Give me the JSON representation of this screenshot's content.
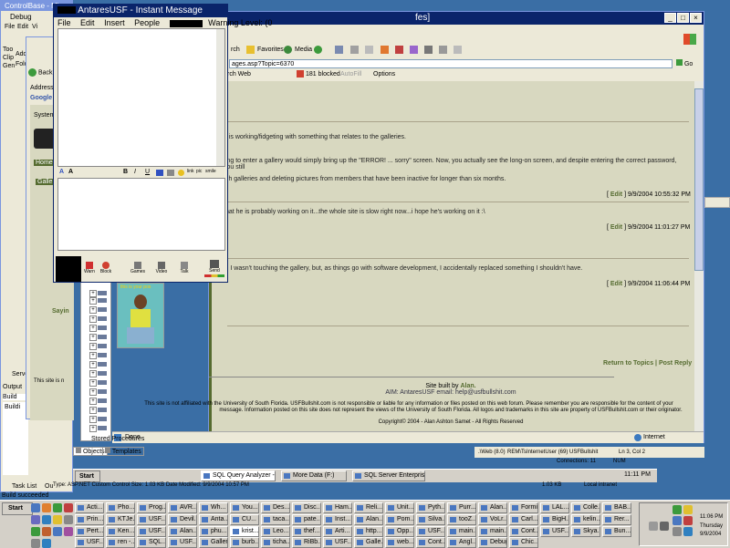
{
  "desktop": {
    "background_color": "#3a6ea5",
    "controlbase_title": "ControlBase - Mi",
    "debug_tab": "Debug",
    "left_menu": [
      "File",
      "Edit",
      "Vi"
    ],
    "left_labels": [
      "Too",
      "Clip",
      "Gen",
      "Addre",
      "Folde"
    ],
    "output_label": "Output",
    "build_label": "Build",
    "building_text": "Buildi",
    "server_label": "Serve",
    "task_list_tab": "Task List",
    "output_tab": "Ou",
    "build_status": "Build succeeded",
    "type_info": "Type: ASP.NET Custom Control  Size: 1.03 KB  Date Modified: 9/9/2004 10:57 PM",
    "type_info_size": "1.03 KB",
    "local_intranet": "Local intranet"
  },
  "im_window": {
    "title": "AntaresUSF - Instant Message",
    "warning": "Warning Level: (0",
    "menu": [
      "File",
      "Edit",
      "Insert",
      "People"
    ],
    "format_buttons": [
      "A",
      "A",
      "B",
      "I",
      "U",
      "link",
      "pic",
      "smile"
    ],
    "bottom_buttons": [
      {
        "icon": "warn-icon",
        "label": "Warn"
      },
      {
        "icon": "block-icon",
        "label": "Block"
      },
      {
        "icon": "games-icon",
        "label": "Games"
      },
      {
        "icon": "video-icon",
        "label": "Video"
      },
      {
        "icon": "talk-icon",
        "label": "Talk"
      },
      {
        "icon": "send-icon",
        "label": "Send"
      }
    ]
  },
  "small_browser": {
    "back_label": "Back",
    "address_label": "Address",
    "google_label": "Google",
    "system_label": "System",
    "home_label": "Home",
    "gallery_label": "Galle",
    "saying_label": "Sayin",
    "site_label": "This site is n"
  },
  "ie_window": {
    "title_suffix": "fes]",
    "toolbar": {
      "search": "rch",
      "favorites": "Favorites",
      "media": "Media"
    },
    "address": "ages.asp?Topic=6370",
    "go_label": "Go",
    "links_row": {
      "search_web": "rch Web",
      "blocked": "181 blocked",
      "autofill": "AutoFill",
      "options": "Options"
    },
    "posts": [
      {
        "text": "n is working/fidgeting with something that relates to the galleries.",
        "meta": null
      },
      {
        "text": "ting to enter a gallery would simply bring up the \"ERROR! ... sorry\" screen. Now, you actually see the long-on screen, and despite entering the correct password, you still",
        "meta": null
      },
      {
        "text": "igh galleries and deleting pictures from members that have been inactive for longer than six months.",
        "meta": {
          "edit": "Edit",
          "date": "9/9/2004 10:55:32 PM"
        }
      },
      {
        "text": "that he is probably working on it...the whole site is slow right now...i hope he's working on it :\\",
        "meta": {
          "edit": "Edit",
          "date": "9/9/2004 11:01:27 PM"
        }
      },
      {
        "text": "s. I wasn't touching the gallery, but, as things go with software development, I accidentally replaced something I shouldn't have.",
        "meta": {
          "edit": "Edit",
          "date": "9/9/2004 11:06:44 PM"
        }
      }
    ],
    "return_label": "Return to Topics",
    "post_reply_label": "Post Reply",
    "footer": {
      "built_by_prefix": "Site built by",
      "built_by_name": "Alan.",
      "aim": "AIM: AntaresUSF email: help@usfbullshit.com",
      "disclaimer_1": "This site is not affiliated with the University of South Florida. USFBullshit.com is not responsible or liable for any information or files posted on this web forum. Please remember you are responsible for the content of your",
      "disclaimer_2": "message. Information posted on this site does not represent the views of the University of South Florida. All logos and trademarks in this site are property of USFBullshit.com or their originator.",
      "copyright": "Copyright© 2004 - Alan Ashton Samet - All Rights Reserved"
    },
    "status_done": "Done",
    "status_zone": "Internet",
    "image_caption": "this is your pos",
    "accent_color": "#556b2f",
    "forum_bg": "#d8d8c0"
  },
  "sql_window": {
    "status_cells": [
      ".\\Web (8.0)",
      "REM\\TsInternetUser (69)",
      "USFBullshit",
      "Ln 3, Col 2"
    ],
    "connections": "Connections: 11",
    "num": "NUM",
    "tree_last": "Stored Procedures",
    "tabs": [
      "Objects",
      "Templates"
    ]
  },
  "taskbar": {
    "start": "Start",
    "items_row1": [
      "SQL Query Analyzer - [...",
      "More Data (F:)",
      "SQL Server Enterprise Ma..."
    ],
    "clock1": "11:11 PM",
    "clock2": "11:06 PM",
    "day": "Thursday",
    "date": "9/9/2004",
    "bottom_tasks_row1": [
      "Acti...",
      "Pho...",
      "Prog...",
      "AVR...",
      "Wh...",
      "You...",
      "Des...",
      "Disc...",
      "Ham...",
      "Reli...",
      "Unit...",
      "Pyth...",
      "Purr...",
      "Alan...",
      "Formi",
      "LAL...",
      "Colle...",
      "BAB..."
    ],
    "bottom_tasks_row2": [
      "Prin...",
      "KTJe...",
      "USF...",
      "Devil...",
      "Anta...",
      "CU...",
      "taca...",
      "pate...",
      "Inst...",
      "Alan...",
      "Pom...",
      "Silva...",
      "tooZ...",
      "VoLr...",
      "Carl...",
      "BigH...",
      "kelin...",
      "Rer..."
    ],
    "bottom_tasks_row3": [
      "Pert...",
      "Ken...",
      "USF...",
      "Alan...",
      "phu...",
      "krist...",
      "Leo...",
      "thef...",
      "Arti...",
      "http...",
      "Opp...",
      "USF...",
      "main...",
      "main...",
      "Cont...",
      "USF...",
      "Skya...",
      "Bun..."
    ],
    "bottom_tasks_row4": [
      "USF...",
      "ren -...",
      "SQL...",
      "USF...",
      "Gallery",
      "burb...",
      "ticha...",
      "RiBb...",
      "USF...",
      "Galle...",
      "web...",
      "Cont...",
      "Angl...",
      "Debug",
      "Chic..."
    ]
  }
}
